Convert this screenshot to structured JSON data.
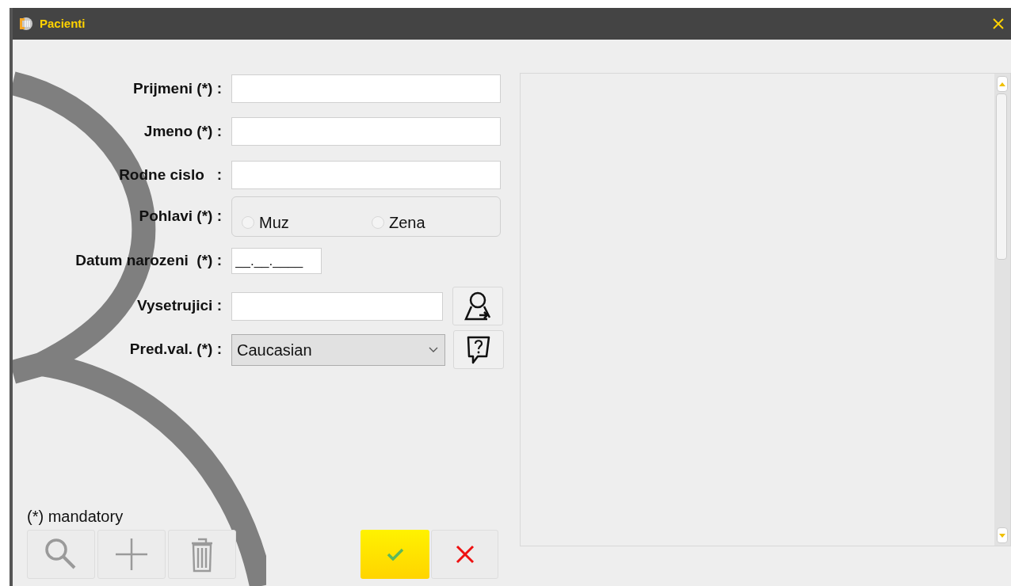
{
  "window": {
    "title": "Pacienti"
  },
  "form": {
    "fields": [
      {
        "kind": "text",
        "label": "Prijmeni (*) :"
      },
      {
        "kind": "text",
        "label": "Jmeno (*) :"
      },
      {
        "kind": "text",
        "label": "Rodne cislo   :"
      },
      {
        "kind": "radio",
        "label": "Pohlavi (*) :",
        "options": [
          {
            "label": "Muz",
            "selected": false
          },
          {
            "label": "Zena",
            "selected": false
          }
        ]
      },
      {
        "kind": "date",
        "label": "Datum narozeni  (*) :",
        "value": "__.__.____"
      },
      {
        "kind": "lookup",
        "label": "Vysetrujici :"
      },
      {
        "kind": "select",
        "label": "Pred.val. (*) :",
        "value": "Caucasian"
      }
    ],
    "note": "(*) mandatory"
  },
  "toolbar": [
    {
      "kind": "search",
      "disabled": true
    },
    {
      "kind": "add",
      "disabled": true
    },
    {
      "kind": "delete",
      "disabled": true
    }
  ],
  "actions": [
    {
      "kind": "confirm"
    },
    {
      "kind": "cancel"
    }
  ]
}
